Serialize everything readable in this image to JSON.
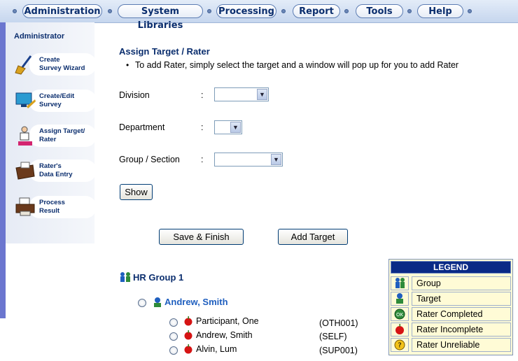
{
  "nav": {
    "items": [
      "Administration",
      "System Libraries",
      "Processing",
      "Report",
      "Tools",
      "Help"
    ]
  },
  "sidebar": {
    "title": "Administrator",
    "items": [
      {
        "label": "Create\nSurvey Wizard",
        "icon": "broom-wizard-icon"
      },
      {
        "label": "Create/Edit\nSurvey",
        "icon": "monitor-edit-icon"
      },
      {
        "label": "Assign Target/\nRater",
        "icon": "assign-person-icon"
      },
      {
        "label": "Rater's\nData Entry",
        "icon": "data-entry-icon"
      },
      {
        "label": "Process\nResult",
        "icon": "printer-process-icon"
      }
    ]
  },
  "main": {
    "heading": "Assign Target / Rater",
    "bullet": "•",
    "note": "To add Rater, simply select the target and a window will pop up for you to add Rater",
    "colon": ":",
    "fields": {
      "division": {
        "label": "Division",
        "value": ""
      },
      "department": {
        "label": "Department",
        "value": ""
      },
      "group": {
        "label": "Group / Section",
        "value": ""
      }
    },
    "show_button": "Show",
    "save_button": "Save & Finish",
    "add_target_button": "Add Target"
  },
  "tree": {
    "group": "HR Group 1",
    "target": "Andrew, Smith",
    "raters": [
      {
        "name": "Participant, One",
        "code": "(OTH001)"
      },
      {
        "name": "Andrew, Smith",
        "code": "(SELF)"
      },
      {
        "name": "Alvin, Lum",
        "code": "(SUP001)"
      }
    ]
  },
  "legend": {
    "title": "LEGEND",
    "items": [
      {
        "label": "Group",
        "icon": "group-icon"
      },
      {
        "label": "Target",
        "icon": "target-person-icon"
      },
      {
        "label": "Rater Completed",
        "icon": "ok-icon"
      },
      {
        "label": "Rater Incomplete",
        "icon": "apple-icon"
      },
      {
        "label": "Rater Unreliable",
        "icon": "question-icon"
      }
    ]
  },
  "colors": {
    "nav_text": "#0b2e6e",
    "link_blue": "#1f5fbf",
    "legend_header": "#0a2a86",
    "legend_bg": "#fffbd6"
  }
}
